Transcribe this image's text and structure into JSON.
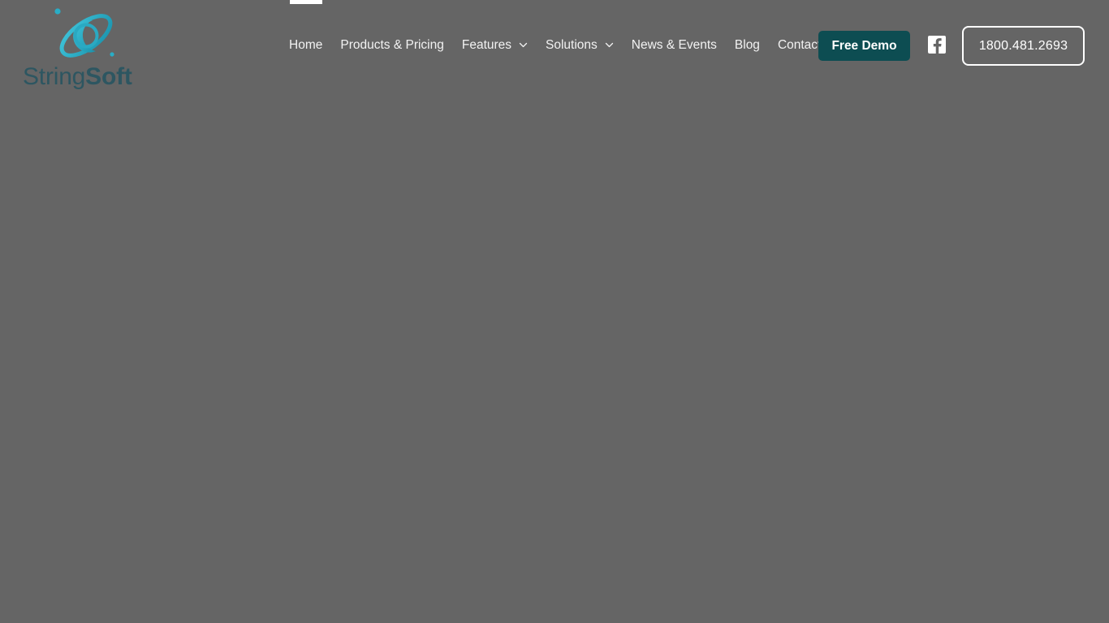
{
  "page": {
    "background_color": "#656565",
    "state": "loading-overlay"
  },
  "header": {
    "loading_bar": {
      "name": "page-load-progress",
      "color": "#ffffff"
    },
    "logo": {
      "name_light": "String",
      "name_bold": "Soft",
      "mark_icon": "orbit-sphere-icon",
      "mark_color": "#27a8c0",
      "word_color": "#2d5661"
    },
    "nav": {
      "items": [
        {
          "label": "Home",
          "has_dropdown": false
        },
        {
          "label": "Products & Pricing",
          "has_dropdown": false
        },
        {
          "label": "Features",
          "has_dropdown": true
        },
        {
          "label": "Solutions",
          "has_dropdown": true
        },
        {
          "label": "News & Events",
          "has_dropdown": false
        },
        {
          "label": "Blog",
          "has_dropdown": false
        },
        {
          "label": "Contact",
          "has_dropdown": false
        }
      ],
      "text_color": "#f2f2f2",
      "dropdown_icon": "chevron-down-icon"
    },
    "demo_button": {
      "label": "Free Demo",
      "background_color": "#0d4d52",
      "text_color": "#ffffff"
    },
    "social": {
      "facebook": {
        "icon": "facebook-icon",
        "label": "Facebook",
        "color": "#ffffff"
      }
    },
    "phone_button": {
      "label": "1800.481.2693",
      "border_color": "#ffffff",
      "text_color": "#ffffff"
    }
  }
}
